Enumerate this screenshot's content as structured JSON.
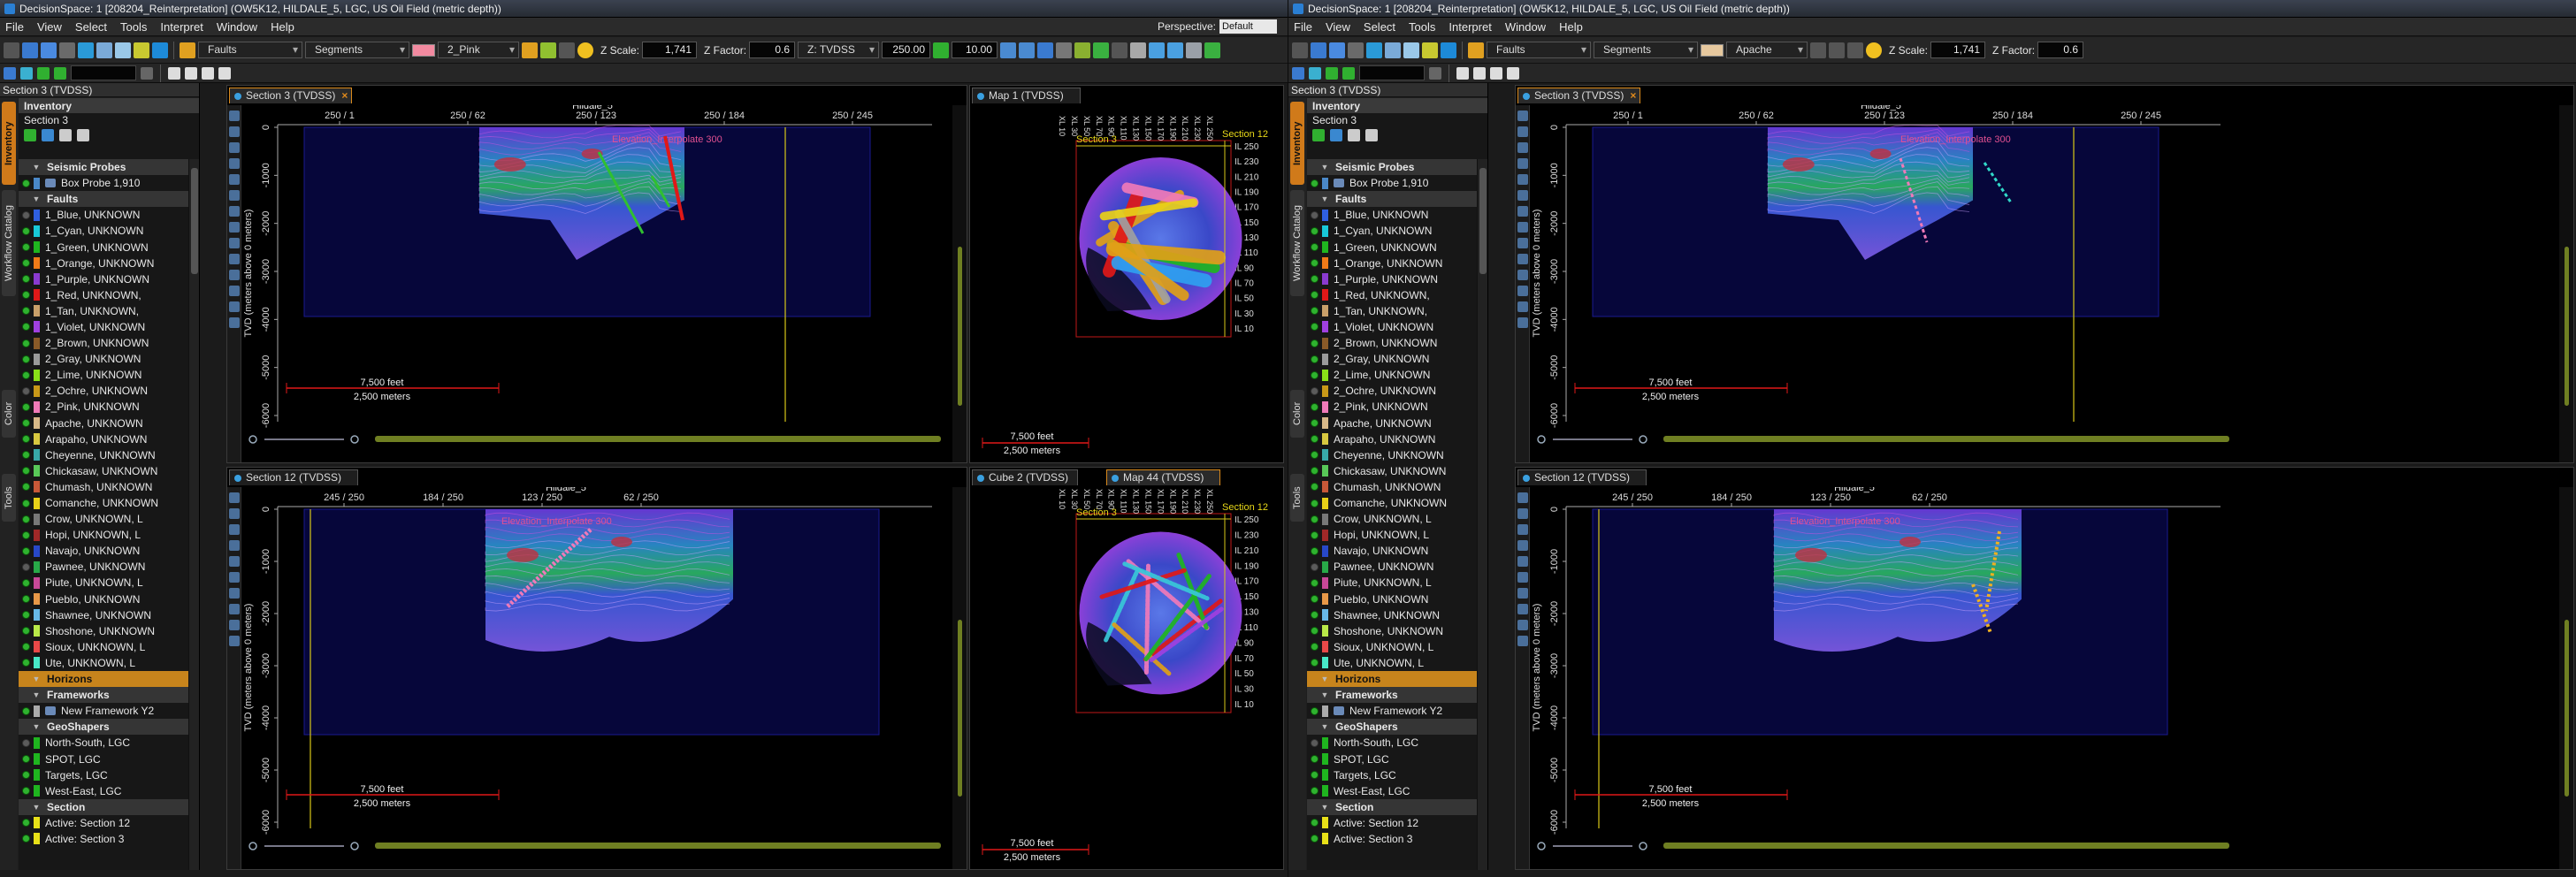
{
  "windows": [
    {
      "title": "DecisionSpace: 1 [208204_Reinterpretation] (OW5K12, HILDALE_5, LGC, US Oil Field (metric depth))",
      "menu": [
        "File",
        "View",
        "Select",
        "Tools",
        "Interpret",
        "Window",
        "Help"
      ],
      "perspective_label": "Perspective:",
      "perspective_value": "Default",
      "toolbar": {
        "object_type": "Faults",
        "mode": "Segments",
        "color_name": "2_Pink",
        "z_scale_label": "Z Scale:",
        "z_scale": "1,741",
        "z_factor_label": "Z Factor:",
        "z_factor": "0.6",
        "domain": "Z: TVDSS",
        "speed": "250.00",
        "step": "10.00"
      },
      "sidebar": {
        "title": "Section 3 (TVDSS)",
        "inventory_title": "Inventory",
        "inventory_sub": "Section 3",
        "vtabs": [
          "Inventory",
          "Workflow Catalog",
          "Color",
          "Tools"
        ]
      }
    },
    {
      "title": "DecisionSpace: 1 [208204_Reinterpretation] (OW5K12, HILDALE_5, LGC, US Oil Field (metric depth))",
      "menu": [
        "File",
        "View",
        "Select",
        "Tools",
        "Interpret",
        "Window",
        "Help"
      ],
      "toolbar": {
        "object_type": "Faults",
        "mode": "Segments",
        "color_name": "Apache",
        "z_scale_label": "Z Scale:",
        "z_scale": "1,741",
        "z_factor_label": "Z Factor:",
        "z_factor": "0.6"
      },
      "sidebar": {
        "title": "Section 3 (TVDSS)",
        "inventory_title": "Inventory",
        "inventory_sub": "Section 3",
        "vtabs": [
          "Inventory",
          "Workflow Catalog",
          "Color",
          "Tools"
        ]
      }
    }
  ],
  "tree": [
    {
      "kind": "group",
      "label": "Seismic Probes"
    },
    {
      "kind": "item",
      "label": "Box Probe 1,910",
      "icon": "box-probe-icon",
      "color": "#4a88c8"
    },
    {
      "kind": "group",
      "label": "Faults"
    },
    {
      "kind": "item",
      "label": "1_Blue, UNKNOWN",
      "color": "#2f5fe0"
    },
    {
      "kind": "item",
      "label": "1_Cyan, UNKNOWN",
      "color": "#18c8d8"
    },
    {
      "kind": "item",
      "label": "1_Green, UNKNOWN",
      "color": "#1fb51f"
    },
    {
      "kind": "item",
      "label": "1_Orange, UNKNOWN",
      "color": "#f07a18"
    },
    {
      "kind": "item",
      "label": "1_Purple, UNKNOWN",
      "color": "#8a3ad0"
    },
    {
      "kind": "item",
      "label": "1_Red, UNKNOWN,",
      "color": "#e01818"
    },
    {
      "kind": "item",
      "label": "1_Tan, UNKNOWN,",
      "color": "#c9a06a"
    },
    {
      "kind": "item",
      "label": "1_Violet, UNKNOWN",
      "color": "#a040e0"
    },
    {
      "kind": "item",
      "label": "2_Brown, UNKNOWN",
      "color": "#8a5a28"
    },
    {
      "kind": "item",
      "label": "2_Gray, UNKNOWN",
      "color": "#9a9a9a"
    },
    {
      "kind": "item",
      "label": "2_Lime, UNKNOWN",
      "color": "#8ae018"
    },
    {
      "kind": "item",
      "label": "2_Ochre, UNKNOWN",
      "color": "#c89818"
    },
    {
      "kind": "item",
      "label": "2_Pink, UNKNOWN",
      "color": "#f07ab8"
    },
    {
      "kind": "item",
      "label": "Apache, UNKNOWN",
      "color": "#d8b888"
    },
    {
      "kind": "item",
      "label": "Arapaho, UNKNOWN",
      "color": "#d8c840"
    },
    {
      "kind": "item",
      "label": "Cheyenne, UNKNOWN",
      "color": "#38a8a8"
    },
    {
      "kind": "item",
      "label": "Chickasaw, UNKNOWN",
      "color": "#58c858"
    },
    {
      "kind": "item",
      "label": "Chumash, UNKNOWN",
      "color": "#c85838"
    },
    {
      "kind": "item",
      "label": "Comanche, UNKNOWN",
      "color": "#e8d018"
    },
    {
      "kind": "item",
      "label": "Crow, UNKNOWN, L",
      "color": "#787878"
    },
    {
      "kind": "item",
      "label": "Hopi, UNKNOWN, L",
      "color": "#a02828"
    },
    {
      "kind": "item",
      "label": "Navajo, UNKNOWN",
      "color": "#2848c8"
    },
    {
      "kind": "item",
      "label": "Pawnee, UNKNOWN",
      "color": "#28a848"
    },
    {
      "kind": "item",
      "label": "Piute, UNKNOWN, L",
      "color": "#c84898"
    },
    {
      "kind": "item",
      "label": "Pueblo, UNKNOWN",
      "color": "#e89848"
    },
    {
      "kind": "item",
      "label": "Shawnee, UNKNOWN",
      "color": "#68b8e8"
    },
    {
      "kind": "item",
      "label": "Shoshone, UNKNOWN",
      "color": "#b8e848"
    },
    {
      "kind": "item",
      "label": "Sioux, UNKNOWN, L",
      "color": "#e84848"
    },
    {
      "kind": "item",
      "label": "Ute, UNKNOWN, L",
      "color": "#48e8c8"
    },
    {
      "kind": "group",
      "label": "Horizons",
      "style": "orange"
    },
    {
      "kind": "group",
      "label": "Frameworks"
    },
    {
      "kind": "item",
      "label": "New Framework Y2",
      "icon": "framework-icon",
      "color": "#aaaaaa"
    },
    {
      "kind": "group",
      "label": "GeoShapers"
    },
    {
      "kind": "item",
      "label": "North-South, LGC",
      "color": "#1fb51f"
    },
    {
      "kind": "item",
      "label": "SPOT, LGC",
      "color": "#1fb51f"
    },
    {
      "kind": "item",
      "label": "Targets, LGC",
      "color": "#1fb51f"
    },
    {
      "kind": "item",
      "label": "West-East, LGC",
      "color": "#1fb51f"
    },
    {
      "kind": "group",
      "label": "Section"
    },
    {
      "kind": "item",
      "label": "Active: Section 12",
      "color": "#e8e018"
    },
    {
      "kind": "item",
      "label": "Active: Section 3",
      "color": "#e8e018"
    }
  ],
  "views": {
    "sec3": {
      "tab": "Section 3 (TVDSS)",
      "well": "Hildale_5",
      "ticks": [
        "250 / 1",
        "250 / 62",
        "250 / 123",
        "250 / 184",
        "250 / 245"
      ],
      "ylabel": "TVD (meters above 0 meters)",
      "yticks": [
        "0",
        "-1000",
        "-2000",
        "-3000",
        "-4000",
        "-5000",
        "-6000"
      ],
      "horizon": "Elevation_Interpolate 300",
      "scale_feet": "7,500 feet",
      "scale_m": "2,500 meters"
    },
    "sec12": {
      "tab": "Section 12 (TVDSS)",
      "well": "Hildale_5",
      "ticks": [
        "245 / 250",
        "184 / 250",
        "123 / 250",
        "62 / 250"
      ],
      "ylabel": "TVD (meters above 0 meters)",
      "yticks": [
        "0",
        "-1000",
        "-2000",
        "-3000",
        "-4000",
        "-5000",
        "-6000"
      ],
      "horizon": "Elevation_Interpolate 300",
      "scale_feet": "7,500 feet",
      "scale_m": "2,500 meters"
    },
    "map1": {
      "tab": "Map 1 (TVDSS)",
      "xl": [
        "XL 10",
        "XL 30",
        "XL 50",
        "XL 70",
        "XL 90",
        "XL 110",
        "XL 130",
        "XL 150",
        "XL 170",
        "XL 190",
        "XL 210",
        "XL 230",
        "XL 250"
      ],
      "il": [
        "IL 250",
        "IL 230",
        "IL 210",
        "IL 190",
        "IL 170",
        "IL 150",
        "IL 130",
        "IL 110",
        "IL 90",
        "IL 70",
        "IL 50",
        "IL 30",
        "IL 10"
      ],
      "sec3": "Section 3",
      "sec12": "Section 12",
      "scale_feet": "7,500 feet",
      "scale_m": "2,500 meters"
    },
    "map44": {
      "tab_a": "Cube 2 (TVDSS)",
      "tab_b": "Map 44 (TVDSS)",
      "scale_feet": "7,500 feet",
      "scale_m": "2,500 meters"
    }
  }
}
